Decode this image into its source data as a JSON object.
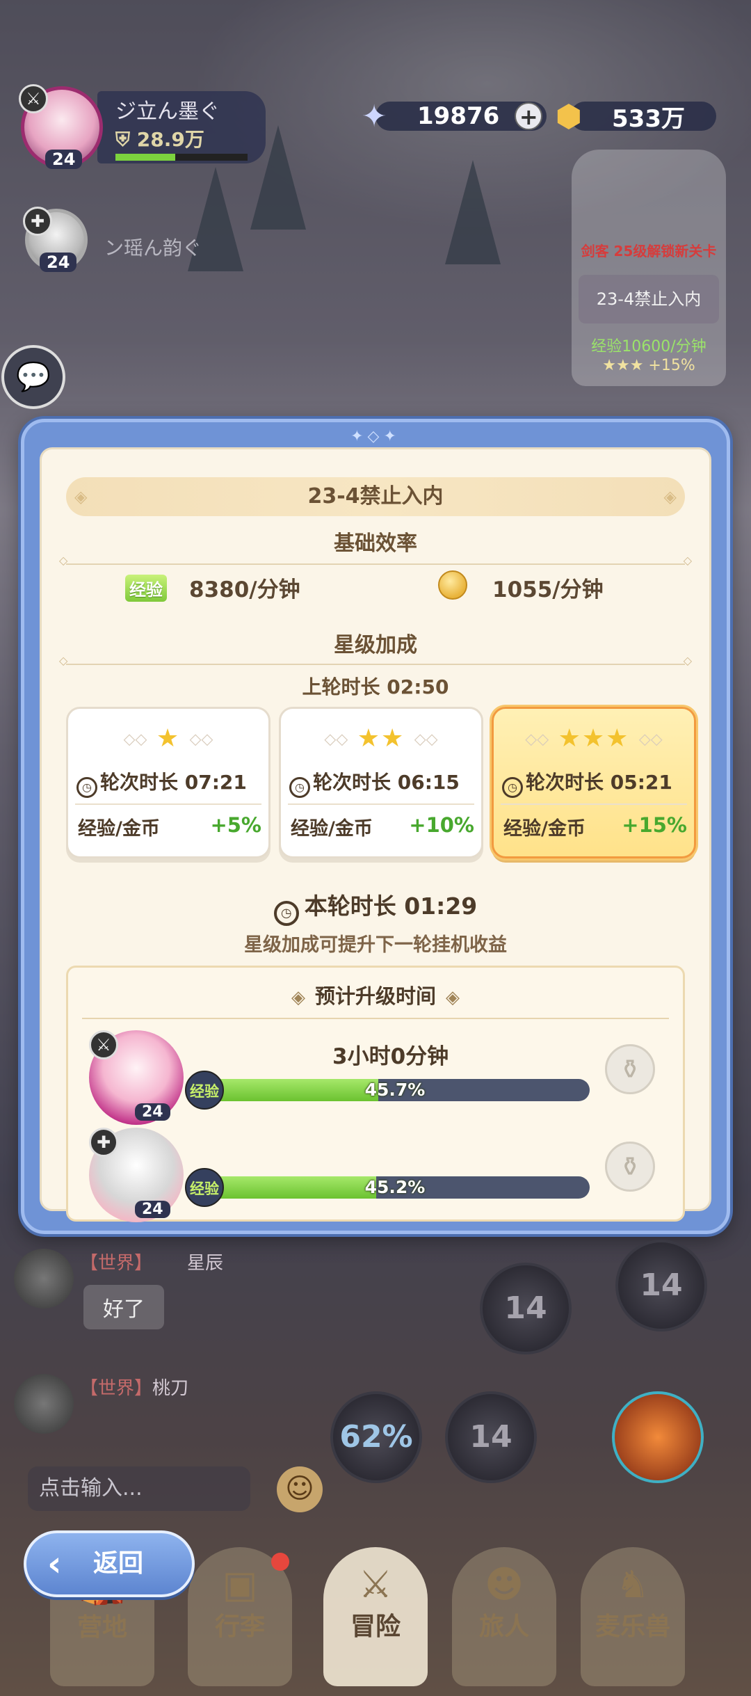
{
  "hud": {
    "player1": {
      "name": "ジ立ん墨ぐ",
      "power": "28.9万",
      "level": "24",
      "hp_fraction": 0.45
    },
    "player2": {
      "name": "ン瑶ん韵ぐ",
      "level": "24"
    },
    "gems": "19876",
    "gold": "533万",
    "plus": "+"
  },
  "side_stage": {
    "unlock": "剑客  25级解锁新关卡",
    "stage": "23-4禁止入内",
    "exp": "经验10600/分钟",
    "bonus": "★★★ +15%"
  },
  "modal": {
    "stage_name": "23-4禁止入内",
    "base_title": "基础效率",
    "exp_tag": "经验",
    "exp_rate": "8380/分钟",
    "coin_rate": "1055/分钟",
    "star_title": "星级加成",
    "last_round": "上轮时长  02:50",
    "cards": [
      {
        "stars": "★",
        "time": "轮次时长  07:21",
        "label": "经验/金币",
        "bonus": "+5%"
      },
      {
        "stars": "★★",
        "time": "轮次时长  06:15",
        "label": "经验/金币",
        "bonus": "+10%"
      },
      {
        "stars": "★★★",
        "time": "轮次时长  05:21",
        "label": "经验/金币",
        "bonus": "+15%"
      }
    ],
    "current_round": "本轮时长  01:29",
    "hint": "星级加成可提升下一轮挂机收益",
    "upgrade_title": "预计升级时间",
    "heroes": [
      {
        "level": "24",
        "time": "3小时0分钟",
        "tag": "经验",
        "progress": "45.7%",
        "fraction": 0.457
      },
      {
        "level": "24",
        "time": "",
        "tag": "经验",
        "progress": "45.2%",
        "fraction": 0.452
      }
    ]
  },
  "chat": {
    "msg1": {
      "channel": "【世界】",
      "name": "星辰",
      "text": "好了"
    },
    "msg2": {
      "channel": "【世界】",
      "name": "桃刀"
    },
    "input_placeholder": "点击输入..."
  },
  "skills": {
    "s1": "14",
    "s2": "14",
    "s3": "62%",
    "s4": "14"
  },
  "back_label": "返回",
  "nav": [
    "营地",
    "行李",
    "冒险",
    "旅人",
    "麦乐兽"
  ],
  "colors": {
    "accent": "#6f93d6",
    "progress": "#7fc93a",
    "active_card": "#ffe28a",
    "bonus_green": "#48a82e"
  }
}
